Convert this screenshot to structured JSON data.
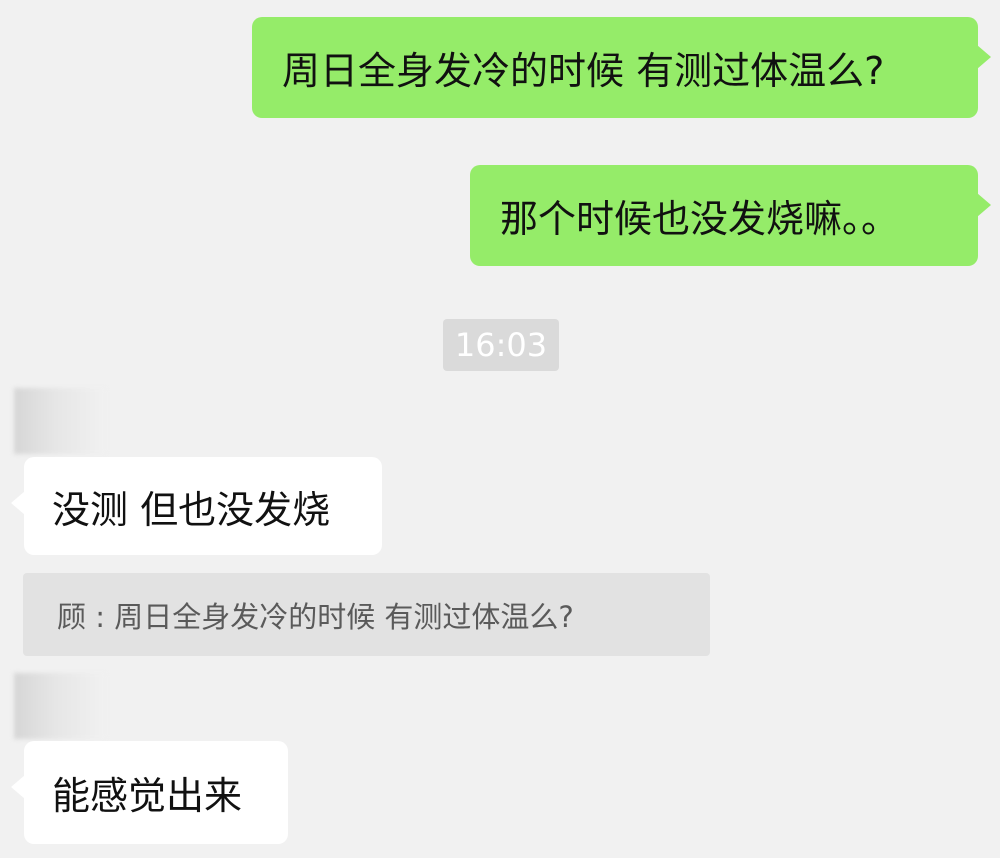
{
  "colors": {
    "background": "#f1f1f1",
    "outgoing_bubble": "#95ec69",
    "incoming_bubble": "#ffffff",
    "quote_background": "#e2e2e2",
    "timestamp_background": "#dadada"
  },
  "messages": [
    {
      "direction": "outgoing",
      "text": "周日全身发冷的时候 有测过体温么?"
    },
    {
      "direction": "outgoing",
      "text": "那个时候也没发烧嘛。。"
    }
  ],
  "timestamp": "16:03",
  "replies": [
    {
      "direction": "incoming",
      "text": "没测 但也没发烧"
    },
    {
      "direction": "incoming",
      "text": "能感觉出来"
    }
  ],
  "quote": {
    "text": "顾 : 周日全身发冷的时候 有测过体温么?"
  }
}
